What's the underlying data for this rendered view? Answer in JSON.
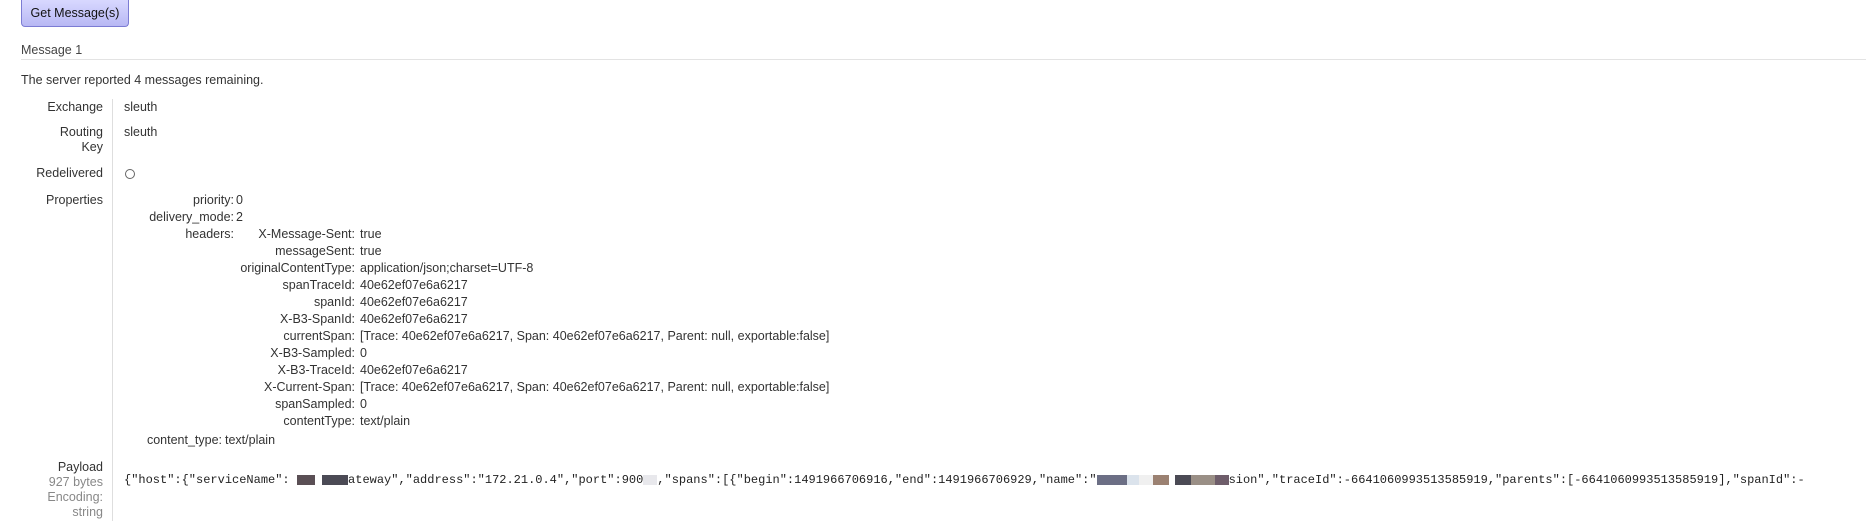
{
  "toolbar": {
    "get_messages_label": "Get Message(s)"
  },
  "message": {
    "title": "Message 1",
    "info": "The server reported 4 messages remaining.",
    "fields": {
      "exchange_label": "Exchange",
      "exchange_value": "sleuth",
      "routing_key_label_1": "Routing",
      "routing_key_label_2": "Key",
      "routing_key_value": "sleuth",
      "redelivered_label": "Redelivered",
      "properties_label": "Properties",
      "payload_label": "Payload",
      "payload_size": "927 bytes",
      "encoding_label": "Encoding:",
      "encoding_value": "string"
    },
    "properties": {
      "priority_key": "priority:",
      "priority_value": "0",
      "delivery_mode_key": "delivery_mode:",
      "delivery_mode_value": "2",
      "headers_key": "headers:",
      "content_type_key": "content_type:",
      "content_type_value": "text/plain"
    },
    "headers": [
      {
        "key": "X-Message-Sent:",
        "value": "true"
      },
      {
        "key": "messageSent:",
        "value": "true"
      },
      {
        "key": "originalContentType:",
        "value": "application/json;charset=UTF-8"
      },
      {
        "key": "spanTraceId:",
        "value": "40e62ef07e6a6217"
      },
      {
        "key": "spanId:",
        "value": "40e62ef07e6a6217"
      },
      {
        "key": "X-B3-SpanId:",
        "value": "40e62ef07e6a6217"
      },
      {
        "key": "currentSpan:",
        "value": "[Trace: 40e62ef07e6a6217, Span: 40e62ef07e6a6217, Parent: null, exportable:false]"
      },
      {
        "key": "X-B3-Sampled:",
        "value": "0"
      },
      {
        "key": "X-B3-TraceId:",
        "value": "40e62ef07e6a6217"
      },
      {
        "key": "X-Current-Span:",
        "value": "[Trace: 40e62ef07e6a6217, Span: 40e62ef07e6a6217, Parent: null, exportable:false]"
      },
      {
        "key": "spanSampled:",
        "value": "0"
      },
      {
        "key": "contentType:",
        "value": "text/plain"
      }
    ],
    "payload": {
      "part1": "{\"host\":{\"serviceName\":",
      "part2": "ateway\",\"address\":\"172.21.0.4\",\"port\":900",
      "part3": ",\"spans\":[{\"begin\":1491966706916,\"end\":1491966706929,\"name\":\"",
      "part4": "sion\",\"traceId\":-6641060993513585919,\"parents\":[-6641060993513585919],\"spanId\":-"
    },
    "colors": {
      "button_bg": "#c8c8fa",
      "button_border": "#7c7cd4",
      "rule": "#e3e3e3"
    }
  }
}
